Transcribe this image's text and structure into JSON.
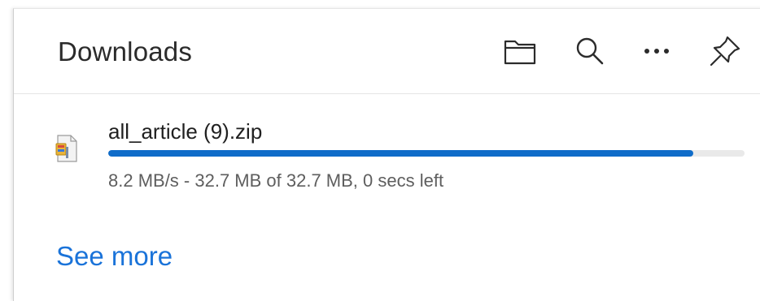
{
  "header": {
    "title": "Downloads",
    "buttons": [
      {
        "name": "open-folder",
        "icon": "folder-icon"
      },
      {
        "name": "search",
        "icon": "search-icon"
      },
      {
        "name": "more-options",
        "icon": "more-dots-icon"
      },
      {
        "name": "pin",
        "icon": "pin-icon"
      }
    ]
  },
  "downloads": [
    {
      "file_name": "all_article (9).zip",
      "progress_percent": 92,
      "status": "8.2 MB/s - 32.7 MB of 32.7 MB, 0 secs left",
      "icon": "zip-file-icon"
    }
  ],
  "footer": {
    "see_more_label": "See more"
  },
  "colors": {
    "accent": "#0f6cc9",
    "link": "#1a73d9",
    "track": "#e9e9e9"
  }
}
